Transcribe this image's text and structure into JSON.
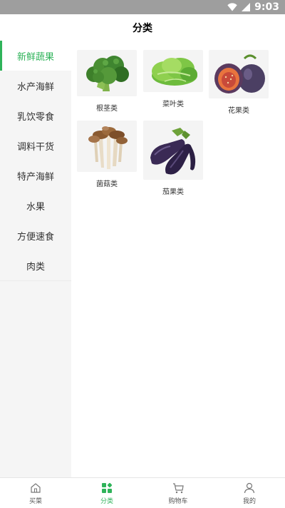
{
  "status_bar": {
    "time": "9:03"
  },
  "header": {
    "title": "分类"
  },
  "sidebar": {
    "items": [
      {
        "label": "新鲜蔬果"
      },
      {
        "label": "水产海鲜"
      },
      {
        "label": "乳饮零食"
      },
      {
        "label": "调料干货"
      },
      {
        "label": "特产海鲜"
      },
      {
        "label": "水果"
      },
      {
        "label": "方便速食"
      },
      {
        "label": "肉类"
      }
    ]
  },
  "categories": [
    {
      "label": "根茎类",
      "icon": "broccoli-image"
    },
    {
      "label": "菜叶类",
      "icon": "lettuce-image"
    },
    {
      "label": "花果类",
      "icon": "fig-image"
    },
    {
      "label": "菌菇类",
      "icon": "mushroom-image"
    },
    {
      "label": "茄果类",
      "icon": "eggplant-image"
    }
  ],
  "tabbar": {
    "items": [
      {
        "label": "买菜",
        "icon": "home-icon"
      },
      {
        "label": "分类",
        "icon": "category-icon"
      },
      {
        "label": "购物车",
        "icon": "cart-icon"
      },
      {
        "label": "我的",
        "icon": "user-icon"
      }
    ]
  },
  "colors": {
    "accent": "#2fb35a",
    "status_bar": "#9e9e9e",
    "sidebar_bg": "#f5f5f5"
  }
}
